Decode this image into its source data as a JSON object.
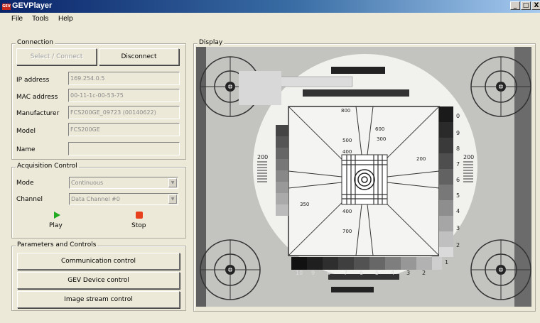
{
  "window": {
    "title": "GEVPlayer",
    "app_icon_text": "GEV",
    "controls": [
      "_",
      "□",
      "X"
    ]
  },
  "menu": [
    "File",
    "Tools",
    "Help"
  ],
  "connection": {
    "group_label": "Connection",
    "select_connect_label": "Select / Connect",
    "disconnect_label": "Disconnect",
    "fields": [
      {
        "label": "IP address",
        "value": "169.254.0.5"
      },
      {
        "label": "MAC address",
        "value": "00-11-1c-00-53-75"
      },
      {
        "label": "Manufacturer",
        "value": "FCS200GE_09723 (00140622)"
      },
      {
        "label": "Model",
        "value": "FCS200GE"
      },
      {
        "label": "Name",
        "value": ""
      }
    ]
  },
  "acquisition": {
    "group_label": "Acquisition Control",
    "mode_label": "Mode",
    "mode_value": "Continuous",
    "channel_label": "Channel",
    "channel_value": "Data Channel #0",
    "play_label": "Play",
    "stop_label": "Stop",
    "colors": {
      "play": "#22aa22",
      "stop": "#e8401c"
    }
  },
  "parameters": {
    "group_label": "Parameters and Controls",
    "buttons": [
      "Communication control",
      "GEV Device control",
      "Image stream control"
    ]
  },
  "display": {
    "group_label": "Display",
    "chart_numbers_left": [
      "800",
      "500",
      "400",
      "600",
      "200",
      "300",
      "350",
      "400",
      "700"
    ],
    "chart_numbers_right": [
      "0",
      "9",
      "8",
      "7",
      "6",
      "5",
      "4",
      "3",
      "2",
      "1"
    ],
    "chart_numbers_bottom": [
      "10",
      "9",
      "8",
      "7",
      "6",
      "5",
      "4",
      "3",
      "2"
    ],
    "chart_side_labels": [
      "200",
      "200"
    ]
  }
}
